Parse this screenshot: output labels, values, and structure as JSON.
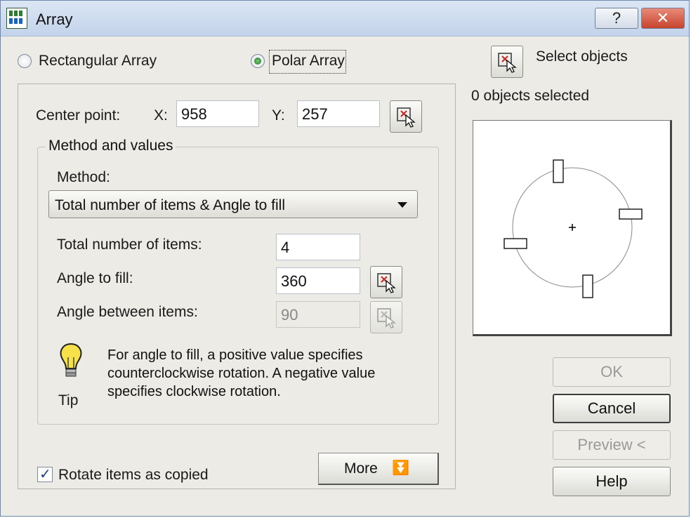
{
  "window": {
    "title": "Array",
    "help_label": "?",
    "close_label": "✕"
  },
  "array_type": {
    "rectangular_label": "Rectangular Array",
    "polar_label": "Polar Array",
    "selected": "polar"
  },
  "selection": {
    "select_label": "Select objects",
    "status": "0 objects selected"
  },
  "center_point": {
    "label": "Center point:",
    "x_label": "X:",
    "x_value": "958",
    "y_label": "Y:",
    "y_value": "257"
  },
  "method_group": {
    "caption": "Method and values",
    "method_label": "Method:",
    "method_value": "Total number of items & Angle to fill",
    "total_items_label": "Total number of items:",
    "total_items_value": "4",
    "angle_fill_label": "Angle to fill:",
    "angle_fill_value": "360",
    "angle_between_label": "Angle between items:",
    "angle_between_value": "90"
  },
  "tip": {
    "label": "Tip",
    "text": "For angle to fill, a positive value specifies counterclockwise rotation.  A negative value specifies clockwise rotation."
  },
  "options": {
    "rotate_label": "Rotate items as copied",
    "rotate_checked": true,
    "more_label": "More"
  },
  "buttons": {
    "ok": "OK",
    "cancel": "Cancel",
    "preview": "Preview <",
    "help": "Help"
  },
  "icons": {
    "app": "autocad-array-icon",
    "pick": "pick-point-icon",
    "select": "select-objects-icon",
    "tip": "lightbulb-icon",
    "more": "double-chevron-down-icon"
  }
}
